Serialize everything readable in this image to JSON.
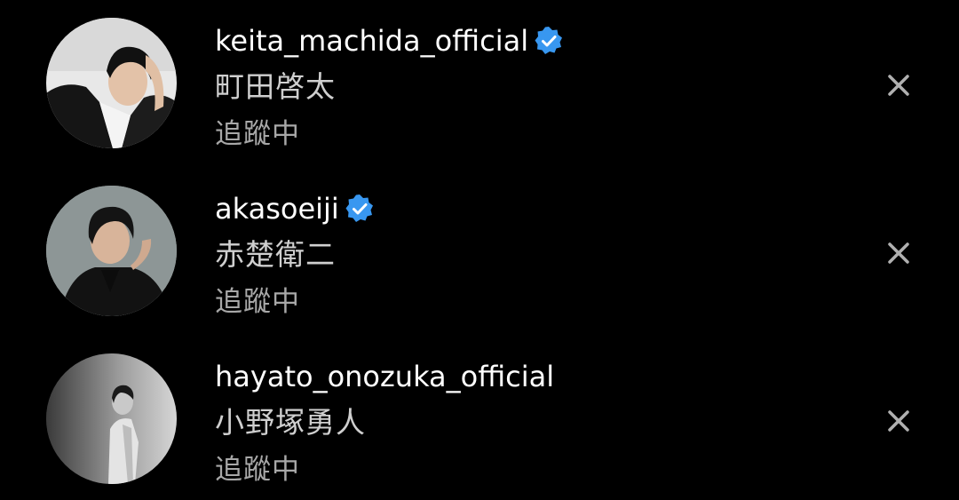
{
  "colors": {
    "background": "#000000",
    "username": "#ffffff",
    "fullname": "#cfcfcf",
    "status": "#a8a8a8",
    "verified_badge": "#3897f0",
    "dismiss": "#b0b0b0"
  },
  "accounts": [
    {
      "username": "keita_machida_official",
      "verified": true,
      "full_name": "町田啓太",
      "status": "追蹤中",
      "avatar_icon": "profile-photo",
      "dismiss_icon": "close-icon"
    },
    {
      "username": "akasoeiji",
      "verified": true,
      "full_name": "赤楚衛二",
      "status": "追蹤中",
      "avatar_icon": "profile-photo",
      "dismiss_icon": "close-icon"
    },
    {
      "username": "hayato_onozuka_official",
      "verified": false,
      "full_name": "小野塚勇人",
      "status": "追蹤中",
      "avatar_icon": "profile-photo",
      "dismiss_icon": "close-icon"
    }
  ]
}
